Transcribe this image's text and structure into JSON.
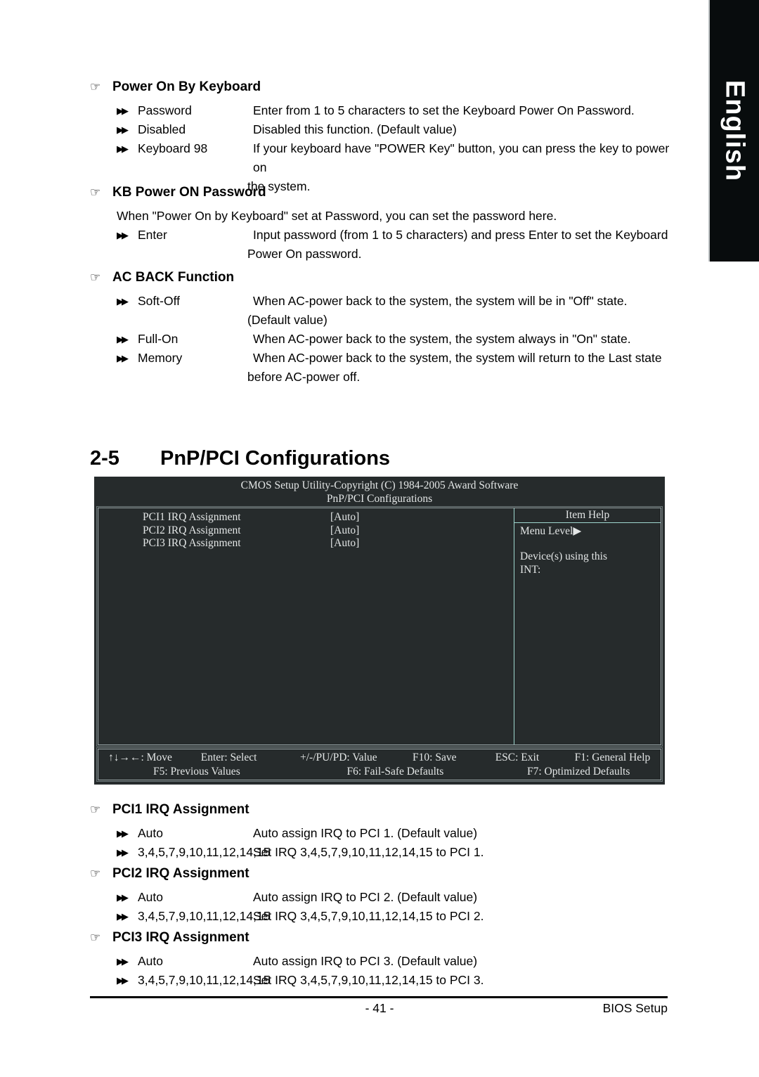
{
  "language_tab": {
    "label": "English"
  },
  "sections": [
    {
      "id": "power-on-by-keyboard",
      "heading": "Power On By Keyboard",
      "options": [
        {
          "label": "Password",
          "desc": "Enter from 1 to 5 characters to set the Keyboard Power On Password."
        },
        {
          "label": "Disabled",
          "desc": "Disabled this function. (Default value)"
        },
        {
          "label": "Keyboard 98",
          "desc": "If your keyboard have \"POWER Key\" button, you can press the key to power on",
          "cont": "the system."
        }
      ]
    },
    {
      "id": "kb-power-on-password",
      "heading": "KB Power ON Password",
      "intro": "When \"Power On by Keyboard\" set at Password, you can set the password here.",
      "options": [
        {
          "label": "Enter",
          "desc": "Input password (from 1 to 5 characters) and press Enter to set the Keyboard",
          "cont": "Power On password."
        }
      ]
    },
    {
      "id": "ac-back-function",
      "heading": "AC BACK Function",
      "options": [
        {
          "label": "Soft-Off",
          "desc": "When AC-power back to the system, the system will be in \"Off\" state.",
          "cont": "(Default value)"
        },
        {
          "label": "Full-On",
          "desc": "When AC-power back to the system, the system always in \"On\" state."
        },
        {
          "label": "Memory",
          "desc": "When AC-power back to the system, the system will return to the Last state",
          "cont": "before AC-power off."
        }
      ]
    }
  ],
  "chapter": {
    "number": "2-5",
    "title": "PnP/PCI Configurations"
  },
  "bios": {
    "title": "CMOS Setup Utility-Copyright (C) 1984-2005 Award Software",
    "subtitle": "PnP/PCI Configurations",
    "rows": [
      {
        "name": "PCI1 IRQ Assignment",
        "value": "[Auto]"
      },
      {
        "name": "PCI2 IRQ Assignment",
        "value": "[Auto]"
      },
      {
        "name": "PCI3 IRQ Assignment",
        "value": "[Auto]"
      }
    ],
    "help": {
      "title": "Item Help",
      "menu_level": "Menu Level",
      "menu_level_arrow": "▶",
      "line1": "Device(s) using this",
      "line2": "INT:"
    },
    "footer": {
      "move": "↑↓→←: Move",
      "select": "Enter: Select",
      "value": "+/-/PU/PD: Value",
      "save": "F10: Save",
      "exit": "ESC: Exit",
      "general_help": "F1: General Help",
      "previous_values": "F5: Previous Values",
      "failsafe": "F6: Fail-Safe Defaults",
      "optimized": "F7: Optimized Defaults"
    }
  },
  "pci_sections": [
    {
      "id": "pci1-irq-assignment",
      "heading": "PCI1 IRQ Assignment",
      "options": [
        {
          "label": "Auto",
          "desc": "Auto assign IRQ to PCI 1. (Default value)"
        },
        {
          "label": "3,4,5,7,9,10,11,12,14,15",
          "desc": "Set IRQ 3,4,5,7,9,10,11,12,14,15 to PCI 1."
        }
      ]
    },
    {
      "id": "pci2-irq-assignment",
      "heading": "PCI2 IRQ Assignment",
      "options": [
        {
          "label": "Auto",
          "desc": "Auto assign IRQ to PCI 2. (Default value)"
        },
        {
          "label": "3,4,5,7,9,10,11,12,14,15",
          "desc": "Set IRQ 3,4,5,7,9,10,11,12,14,15 to PCI 2."
        }
      ]
    },
    {
      "id": "pci3-irq-assignment",
      "heading": "PCI3 IRQ Assignment",
      "options": [
        {
          "label": "Auto",
          "desc": "Auto assign IRQ to PCI 3. (Default value)"
        },
        {
          "label": "3,4,5,7,9,10,11,12,14,15",
          "desc": "Set IRQ 3,4,5,7,9,10,11,12,14,15 to PCI 3."
        }
      ]
    }
  ],
  "glyphs": {
    "hand": "☞",
    "bullet": "▶▶"
  },
  "page_footer": {
    "page_number": "- 41 -",
    "right_label": "BIOS Setup"
  }
}
